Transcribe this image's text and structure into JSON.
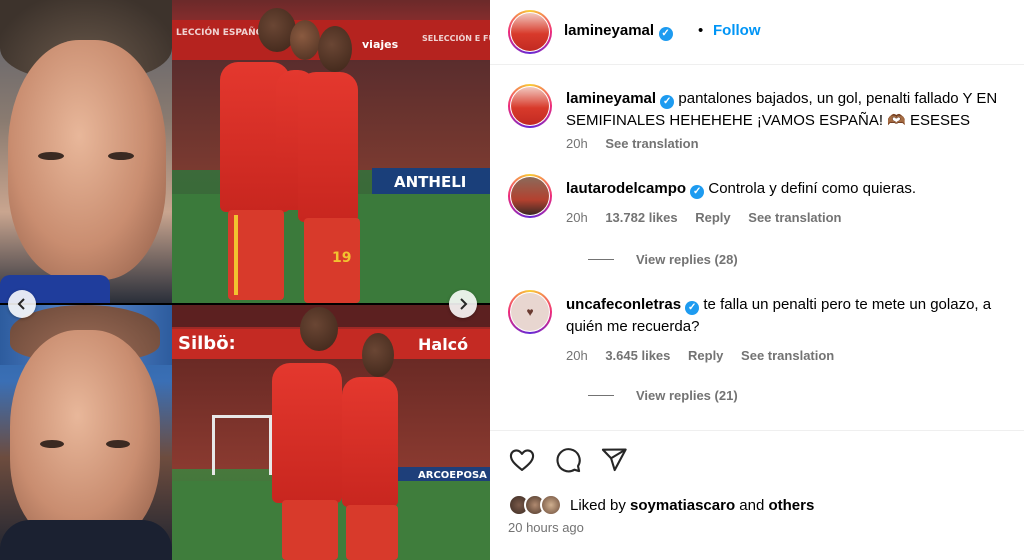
{
  "post": {
    "username": "lamineyamal",
    "verified": true,
    "separator": "•",
    "follow_label": "Follow"
  },
  "media": {
    "banner_top_left_text": "LECCIÓN ESPAÑOLA",
    "banner_viajes": "viajes",
    "banner_seleccion": "SELECCIÓN E FÚTBOL",
    "banner_anthelios": "ANTHELI",
    "banner_silbo_top": "Silbö",
    "banner_silbo_bottom": "Silbö:",
    "banner_halcon": "Halcó",
    "banner_arcoepos": "ARCOEPOSA",
    "player_number": "19",
    "prev_icon": "chevron-left-icon",
    "next_icon": "chevron-right-icon"
  },
  "caption": {
    "username": "lamineyamal",
    "text": "pantalones bajados, un gol, penalti fallado Y EN SEMIFINALES HEHEHEHE ¡VAMOS ESPAÑA! 🫶🏾 ESESES",
    "time": "20h",
    "see_translation": "See translation"
  },
  "comments": [
    {
      "username": "lautarodelcampo",
      "verified": true,
      "text": "Controla y definí como quieras.",
      "time": "20h",
      "likes": "13.782 likes",
      "reply": "Reply",
      "see_translation": "See translation",
      "view_replies": "View replies (28)"
    },
    {
      "username": "uncafeconletras",
      "verified": true,
      "text": "te falla un penalti pero te mete un golazo, a quién me recuerda?",
      "time": "20h",
      "likes": "3.645 likes",
      "reply": "Reply",
      "see_translation": "See translation",
      "view_replies": "View replies (21)"
    }
  ],
  "actions": {
    "like_icon": "heart-icon",
    "comment_icon": "comment-bubble-icon",
    "share_icon": "paper-plane-icon"
  },
  "likes_summary": {
    "prefix": "Liked by",
    "user": "soymatiascaro",
    "and": "and",
    "others": "others"
  },
  "posted_ago": "20 hours ago",
  "colors": {
    "accent": "#0095f6",
    "verified": "#1d9bf0",
    "muted": "#737373"
  }
}
